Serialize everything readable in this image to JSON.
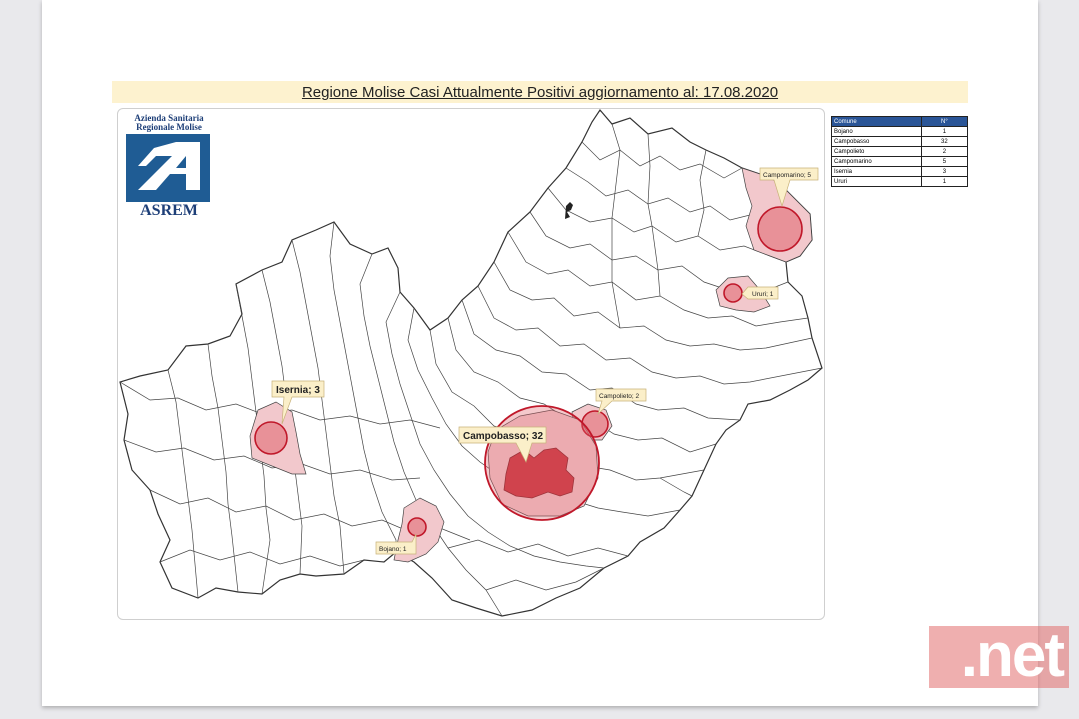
{
  "title": "Regione Molise Casi Attualmente Positivi aggiornamento al: 17.08.2020",
  "logo": {
    "line1": "Azienda Sanitaria",
    "line2": "Regionale Molise",
    "brand": "ASREM"
  },
  "callouts": {
    "campomarino": "Campomarino; 5",
    "ururi": "Ururi; 1",
    "isernia": "Isernia; 3",
    "campolieto": "Campolieto; 2",
    "campobasso": "Campobasso; 32",
    "bojano": "Bojano; 1"
  },
  "table": {
    "headers": [
      "Comune",
      "N°"
    ],
    "rows": [
      [
        "Bojano",
        "1"
      ],
      [
        "Campobasso",
        "32"
      ],
      [
        "Campolieto",
        "2"
      ],
      [
        "Campomarino",
        "5"
      ],
      [
        "Isernia",
        "3"
      ],
      [
        "Ururi",
        "1"
      ]
    ]
  },
  "colors": {
    "bubble_fill": "#e0646e",
    "bubble_stroke": "#c0182a",
    "municipality_highlight": "#f2c8cc",
    "campobasso_area": "#c8323c",
    "callout_fill": "#fbefc9",
    "table_header": "#2a5597"
  },
  "watermark": ".net"
}
